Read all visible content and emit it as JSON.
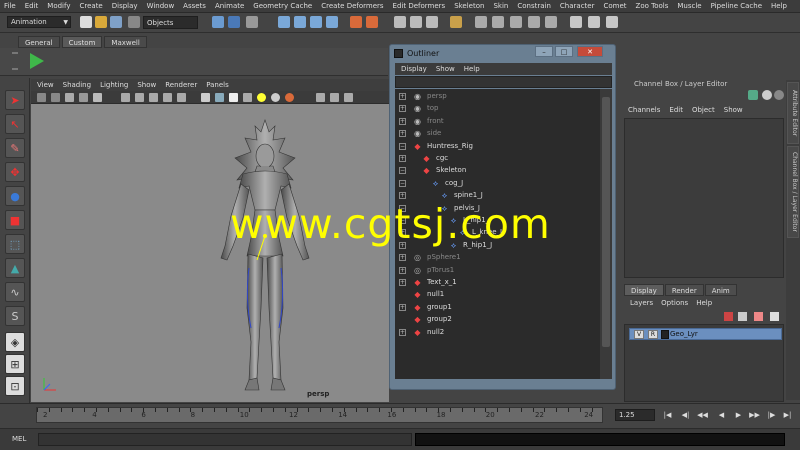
{
  "menubar": [
    "File",
    "Edit",
    "Modify",
    "Create",
    "Display",
    "Window",
    "Assets",
    "Animate",
    "Geometry Cache",
    "Create Deformers",
    "Edit Deformers",
    "Skeleton",
    "Skin",
    "Constrain",
    "Character",
    "Comet",
    "Zoo Tools",
    "Muscle",
    "Pipeline Cache",
    "Help"
  ],
  "status": {
    "mode": "Animation",
    "objects_label": "Objects"
  },
  "shelf": {
    "tabs": [
      "General",
      "Custom",
      "Maxwell"
    ],
    "active": "Custom"
  },
  "viewport": {
    "menu": [
      "View",
      "Shading",
      "Lighting",
      "Show",
      "Renderer",
      "Panels"
    ],
    "camera_label": "persp"
  },
  "outliner": {
    "title": "Outliner",
    "menu": [
      "Display",
      "Show",
      "Help"
    ],
    "items": [
      {
        "label": "persp",
        "icon": "camera",
        "indent": 0,
        "expand": "+",
        "dim": true
      },
      {
        "label": "top",
        "icon": "camera",
        "indent": 0,
        "expand": "+",
        "dim": true
      },
      {
        "label": "front",
        "icon": "camera",
        "indent": 0,
        "expand": "+",
        "dim": true
      },
      {
        "label": "side",
        "icon": "camera",
        "indent": 0,
        "expand": "+",
        "dim": true
      },
      {
        "label": "Huntress_Rig",
        "icon": "transform",
        "indent": 0,
        "expand": "−",
        "dim": false
      },
      {
        "label": "cgc",
        "icon": "transform",
        "indent": 1,
        "expand": "+",
        "dim": false
      },
      {
        "label": "Skeleton",
        "icon": "transform",
        "indent": 1,
        "expand": "−",
        "dim": false
      },
      {
        "label": "cog_J",
        "icon": "joint",
        "indent": 2,
        "expand": "−",
        "dim": false
      },
      {
        "label": "spine1_J",
        "icon": "joint",
        "indent": 3,
        "expand": "+",
        "dim": false
      },
      {
        "label": "pelvis_J",
        "icon": "joint",
        "indent": 3,
        "expand": "−",
        "dim": false
      },
      {
        "label": "L_hip1_J",
        "icon": "joint",
        "indent": 4,
        "expand": "−",
        "dim": false
      },
      {
        "label": "L_knee_J",
        "icon": "joint",
        "indent": 5,
        "expand": "+",
        "dim": false
      },
      {
        "label": "R_hip1_J",
        "icon": "joint",
        "indent": 4,
        "expand": "+",
        "dim": false
      },
      {
        "label": "pSphere1",
        "icon": "mesh",
        "indent": 0,
        "expand": "+",
        "dim": true
      },
      {
        "label": "pTorus1",
        "icon": "mesh",
        "indent": 0,
        "expand": "+",
        "dim": true
      },
      {
        "label": "Text_x_1",
        "icon": "transform",
        "indent": 0,
        "expand": "+",
        "dim": false
      },
      {
        "label": "null1",
        "icon": "transform",
        "indent": 0,
        "expand": "",
        "dim": false
      },
      {
        "label": "group1",
        "icon": "transform",
        "indent": 0,
        "expand": "+",
        "dim": false
      },
      {
        "label": "group2",
        "icon": "transform",
        "indent": 0,
        "expand": "",
        "dim": false
      },
      {
        "label": "null2",
        "icon": "transform",
        "indent": 0,
        "expand": "+",
        "dim": false
      }
    ]
  },
  "channelbox": {
    "header": "Channel Box / Layer Editor",
    "menu": [
      "Channels",
      "Edit",
      "Object",
      "Show"
    ]
  },
  "layers": {
    "tabs": [
      "Display",
      "Render",
      "Anim"
    ],
    "active": "Display",
    "menu": [
      "Layers",
      "Options",
      "Help"
    ],
    "layer_v": "V",
    "layer_r": "R",
    "layer_name": "Geo_Lyr"
  },
  "sidetabs": [
    "Attribute Editor",
    "Channel Box / Layer Editor"
  ],
  "timeline": {
    "ticks": [
      "2",
      "4",
      "6",
      "8",
      "10",
      "12",
      "14",
      "16",
      "18",
      "20",
      "22",
      "24"
    ],
    "current_time": "1.25"
  },
  "mel": {
    "label": "MEL"
  },
  "watermark": "www.cgtsj.com",
  "colors": {
    "panel": "#444444",
    "outliner_frame": "#6a7f92",
    "layer_selected": "#6b8fbf",
    "watermark": "#ffff00"
  }
}
